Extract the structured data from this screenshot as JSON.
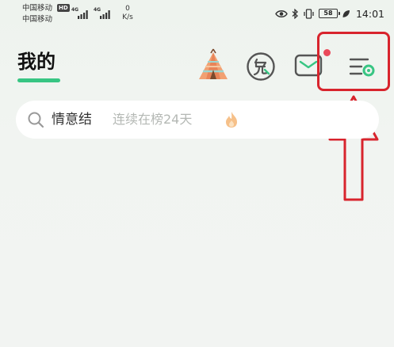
{
  "status_bar": {
    "carrier_1": "中国移动",
    "carrier_2": "中国移动",
    "hd": "HD",
    "sim1_gen": "4G",
    "sim2_gen": "4G",
    "net_speed_value": "0",
    "net_speed_unit": "K/s",
    "battery": "58",
    "time": "14:01"
  },
  "header": {
    "title": "我的"
  },
  "search": {
    "keyword": "情意结",
    "hint": "连续在榜24天"
  },
  "colors": {
    "accent_green": "#38c583",
    "annotation_red": "#d8242d",
    "notification_dot": "#ea4a5a"
  },
  "icons": {
    "tent": "tent-icon",
    "free": "free-badge-icon",
    "mail": "mail-icon",
    "menu": "menu-settings-icon",
    "search": "search-icon",
    "fire": "fire-icon"
  }
}
